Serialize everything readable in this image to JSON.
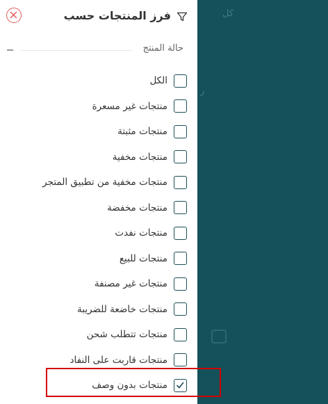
{
  "backdrop": {
    "text_top": "كل",
    "text_mid": "ر"
  },
  "filter_panel": {
    "title": "فرز المنتجات حسب",
    "filter_icon": "funnel-icon",
    "close_icon": "close-icon",
    "section_title": "حالة المنتج",
    "options": [
      {
        "label": "الكل",
        "checked": false
      },
      {
        "label": "منتجات غير مسعرة",
        "checked": false
      },
      {
        "label": "منتجات مثبتة",
        "checked": false
      },
      {
        "label": "منتجات مخفية",
        "checked": false
      },
      {
        "label": "منتجات مخفية من تطبيق المتجر",
        "checked": false
      },
      {
        "label": "منتجات مخفضة",
        "checked": false
      },
      {
        "label": "منتجات نفدت",
        "checked": false
      },
      {
        "label": "منتجات للبيع",
        "checked": false
      },
      {
        "label": "منتجات غير مصنفة",
        "checked": false
      },
      {
        "label": "منتجات خاضعة للضريبة",
        "checked": false
      },
      {
        "label": "منتجات تتطلب شحن",
        "checked": false
      },
      {
        "label": "منتجات قاربت على النفاد",
        "checked": false
      },
      {
        "label": "منتجات بدون وصف",
        "checked": true
      }
    ]
  },
  "colors": {
    "backdrop": "#14525b",
    "checkbox_border": "#1b4e58",
    "close": "#e05a5a",
    "highlight": "#d40000"
  }
}
